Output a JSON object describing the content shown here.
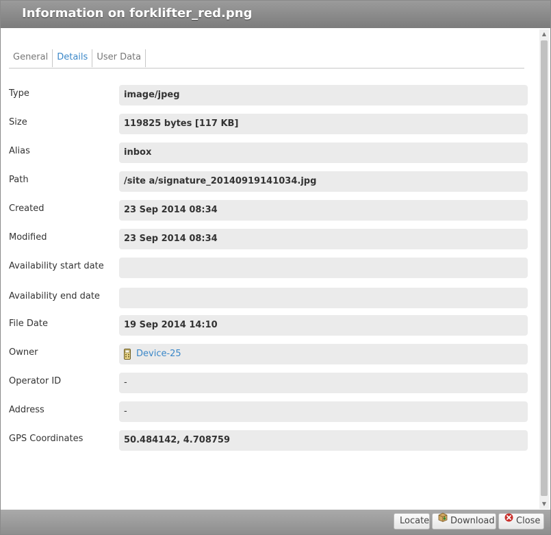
{
  "dialog": {
    "title": "Information on forklifter_red.png"
  },
  "tabs": [
    {
      "label": "General",
      "active": false
    },
    {
      "label": "Details",
      "active": true
    },
    {
      "label": "User Data",
      "active": false
    }
  ],
  "details": {
    "type": {
      "label": "Type",
      "value": "image/jpeg"
    },
    "size": {
      "label": "Size",
      "value": "119825 bytes [117 KB]"
    },
    "alias": {
      "label": "Alias",
      "value": "inbox"
    },
    "path": {
      "label": "Path",
      "value": "/site a/signature_20140919141034.jpg"
    },
    "created": {
      "label": "Created",
      "value": "23 Sep 2014 08:34"
    },
    "modified": {
      "label": "Modified",
      "value": "23 Sep 2014 08:34"
    },
    "availability_start": {
      "label": "Availability start date",
      "value": ""
    },
    "availability_end": {
      "label": "Availability end date",
      "value": ""
    },
    "file_date": {
      "label": "File Date",
      "value": "19 Sep 2014 14:10"
    },
    "owner": {
      "label": "Owner",
      "value": "Device-25",
      "icon": "mobile-phone-icon"
    },
    "operator_id": {
      "label": "Operator ID",
      "value": "-"
    },
    "address": {
      "label": "Address",
      "value": "-"
    },
    "gps": {
      "label": "GPS Coordinates",
      "value": "50.484142, 4.708759"
    }
  },
  "footer": {
    "locate_label": "Locate",
    "download_label": "Download",
    "download_icon": "package-download-icon",
    "close_label": "Close",
    "close_icon": "close-circle-icon",
    "close_icon_color": "#c9302c"
  }
}
